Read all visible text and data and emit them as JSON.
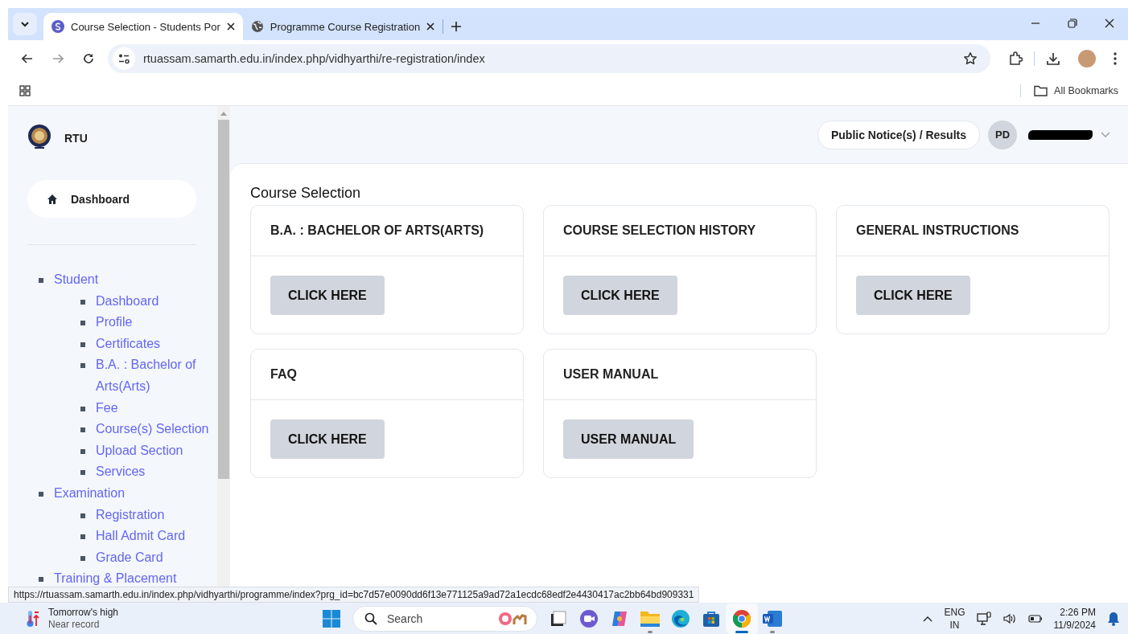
{
  "browser": {
    "tabs": [
      {
        "title": "Course Selection - Students Por",
        "selected": true,
        "kind": "site"
      },
      {
        "title": "Programme Course Registration",
        "selected": false,
        "kind": "globe"
      }
    ],
    "address": "rtuassam.samarth.edu.in/index.php/vidhyarthi/re-registration/index",
    "bookmarks": "All Bookmarks",
    "status_url": "https://rtuassam.samarth.edu.in/index.php/vidhyarthi/programme/index?prg_id=bc7d57e0090dd6f13e771125a9ad72a1ecdc68edf2e4430417ac2bb64bd909331"
  },
  "sidebar": {
    "brand": "RTU",
    "dashboard": "Dashboard",
    "nav": [
      {
        "label": "Student",
        "children": [
          {
            "label": "Dashboard"
          },
          {
            "label": "Profile"
          },
          {
            "label": "Certificates"
          },
          {
            "label": "B.A. : Bachelor of Arts(Arts)"
          },
          {
            "label": "Fee"
          },
          {
            "label": "Course(s) Selection"
          },
          {
            "label": "Upload Section"
          },
          {
            "label": "Services"
          }
        ]
      },
      {
        "label": "Examination",
        "children": [
          {
            "label": "Registration"
          },
          {
            "label": "Hall Admit Card"
          },
          {
            "label": "Grade Card"
          }
        ]
      },
      {
        "label": "Training & Placement"
      }
    ]
  },
  "header": {
    "notice_button": "Public Notice(s) / Results",
    "avatar": "PD"
  },
  "page": {
    "title": "Course Selection",
    "cards": [
      {
        "title": "B.A. : BACHELOR OF ARTS(ARTS)",
        "button": "CLICK HERE"
      },
      {
        "title": "COURSE SELECTION HISTORY",
        "button": "CLICK HERE"
      },
      {
        "title": "GENERAL INSTRUCTIONS",
        "button": "CLICK HERE"
      },
      {
        "title": "FAQ",
        "button": "CLICK HERE"
      },
      {
        "title": "USER MANUAL",
        "button": "USER MANUAL"
      }
    ]
  },
  "taskbar": {
    "weather": {
      "title": "Tomorrow's high",
      "subtitle": "Near record"
    },
    "search": "Search",
    "apps": [
      {
        "kind": "desktop",
        "open": false,
        "selected": false
      },
      {
        "kind": "meet",
        "open": false,
        "selected": false
      },
      {
        "kind": "copilot",
        "open": false,
        "selected": false
      },
      {
        "kind": "folder",
        "open": true,
        "selected": false
      },
      {
        "kind": "edge",
        "open": false,
        "selected": false
      },
      {
        "kind": "store",
        "open": false,
        "selected": false
      },
      {
        "kind": "chrome",
        "open": true,
        "selected": true
      },
      {
        "kind": "word",
        "open": true,
        "selected": false
      }
    ],
    "language": "ENG",
    "region": "IN",
    "time": "2:26 PM",
    "date": "11/9/2024"
  }
}
